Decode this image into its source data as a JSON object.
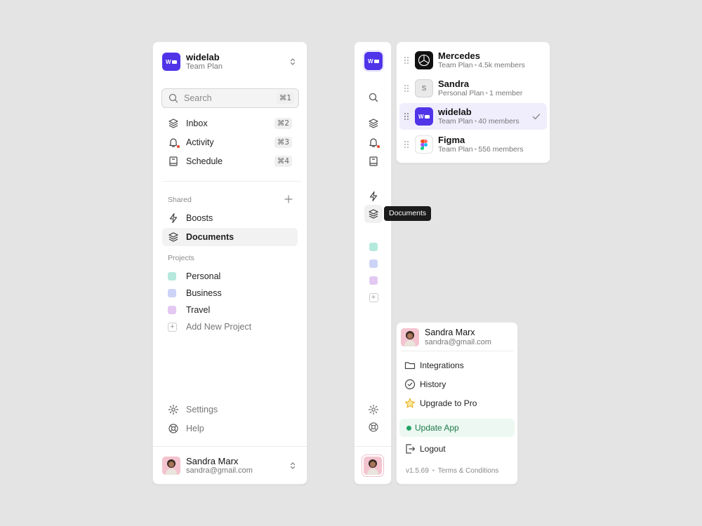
{
  "workspace": {
    "name": "widelab",
    "plan": "Team Plan",
    "logo_text": "W"
  },
  "search": {
    "placeholder": "Search",
    "shortcut": "⌘1"
  },
  "nav": [
    {
      "label": "Inbox",
      "shortcut": "⌘2",
      "icon": "stack-icon"
    },
    {
      "label": "Activity",
      "shortcut": "⌘3",
      "icon": "bell-icon"
    },
    {
      "label": "Schedule",
      "shortcut": "⌘4",
      "icon": "book-icon"
    }
  ],
  "shared": {
    "title": "Shared",
    "items": [
      {
        "label": "Boosts",
        "icon": "bolt-icon"
      },
      {
        "label": "Documents",
        "icon": "stack-icon",
        "active": true
      }
    ]
  },
  "projects": {
    "title": "Projects",
    "items": [
      {
        "label": "Personal",
        "color": "#b6e9dd"
      },
      {
        "label": "Business",
        "color": "#cdd3f6"
      },
      {
        "label": "Travel",
        "color": "#e3c9f2"
      }
    ],
    "add_label": "Add New Project"
  },
  "footer_nav": [
    {
      "label": "Settings",
      "icon": "gear-icon"
    },
    {
      "label": "Help",
      "icon": "lifebuoy-icon"
    }
  ],
  "user": {
    "name": "Sandra Marx",
    "email": "sandra@gmail.com"
  },
  "tooltip": {
    "text": "Documents"
  },
  "workspaces": [
    {
      "name": "Mercedes",
      "plan": "Team Plan",
      "members": "4.5k members",
      "logo": "mercedes-logo-icon"
    },
    {
      "name": "Sandra",
      "plan": "Personal Plan",
      "members": "1 member",
      "logo_text": "S"
    },
    {
      "name": "widelab",
      "plan": "Team Plan",
      "members": "40 members",
      "logo_text": "W",
      "selected": true
    },
    {
      "name": "Figma",
      "plan": "Team Plan",
      "members": "556 members",
      "logo": "figma-logo-icon"
    }
  ],
  "account_menu": {
    "items": [
      {
        "label": "Integrations",
        "icon": "folder-icon"
      },
      {
        "label": "History",
        "icon": "clock-check-icon"
      },
      {
        "label": "Upgrade to Pro",
        "icon": "star-icon"
      }
    ],
    "update_label": "Update App",
    "logout_label": "Logout",
    "version": "v1.5.69",
    "terms": "Terms & Conditions"
  },
  "colors": {
    "brand": "#4f34e8",
    "update_green": "#22a366",
    "alert_red": "#e4472e",
    "star": "#e7b321"
  }
}
